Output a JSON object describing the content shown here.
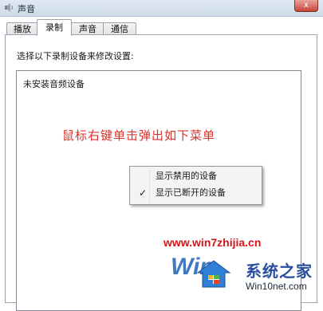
{
  "window": {
    "title": "声音",
    "close_label": "x"
  },
  "tabs": [
    {
      "label": "播放",
      "active": false
    },
    {
      "label": "录制",
      "active": true
    },
    {
      "label": "声音",
      "active": false
    },
    {
      "label": "通信",
      "active": false
    }
  ],
  "recording": {
    "instruction": "选择以下录制设备来修改设置:",
    "empty_message": "未安装音频设备",
    "annotation": "鼠标右键单击弹出如下菜单"
  },
  "context_menu": {
    "items": [
      {
        "label": "显示禁用的设备",
        "checked": false
      },
      {
        "label": "显示已断开的设备",
        "checked": true
      }
    ],
    "check_glyph": "✓"
  },
  "watermark": {
    "url": "www.win7zhijia.cn",
    "win_text": "Win",
    "brand_cn": "系统之家",
    "brand_en": "Win10net.com"
  },
  "colors": {
    "annotation": "#d9322a",
    "watermark_url": "#d4141a",
    "brand_blue": "#2b4f9e"
  }
}
